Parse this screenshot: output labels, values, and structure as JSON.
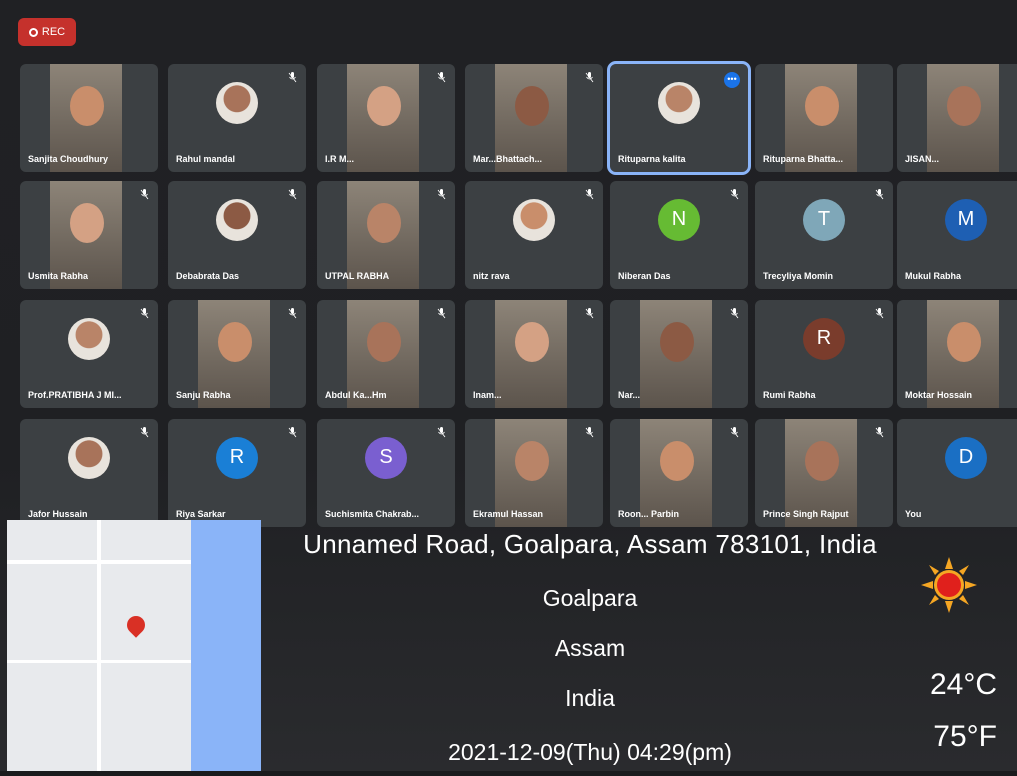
{
  "rec_label": "REC",
  "participants": [
    {
      "name": "Sanjita Choudhury",
      "kind": "photo"
    },
    {
      "name": "Rahul mandal",
      "kind": "avatar-img",
      "muted": true
    },
    {
      "name": "I.R M...",
      "kind": "photo",
      "muted": true
    },
    {
      "name": "Mar...Bhattach...",
      "kind": "photo",
      "muted": true
    },
    {
      "name": "Rituparna kalita",
      "kind": "avatar-img",
      "active": true
    },
    {
      "name": "Rituparna Bhatta...",
      "kind": "photo"
    },
    {
      "name": "JISAN...",
      "kind": "photo",
      "muted": true
    },
    {
      "name": "Usmita Rabha",
      "kind": "photo",
      "muted": true
    },
    {
      "name": "Debabrata Das",
      "kind": "avatar-img",
      "muted": true
    },
    {
      "name": "UTPAL RABHA",
      "kind": "photo",
      "muted": true
    },
    {
      "name": "nitz rava",
      "kind": "avatar-img",
      "muted": true
    },
    {
      "name": "Niberan Das",
      "kind": "letter",
      "letter": "N",
      "color": "#66bb33",
      "muted": true
    },
    {
      "name": "Trecyliya Momin",
      "kind": "letter",
      "letter": "T",
      "color": "#7fa7b8",
      "muted": true
    },
    {
      "name": "Mukul Rabha",
      "kind": "letter",
      "letter": "M",
      "color": "#1e5fb3",
      "muted": true
    },
    {
      "name": "Prof.PRATIBHA J MI...",
      "kind": "avatar-img",
      "muted": true
    },
    {
      "name": "Sanju Rabha",
      "kind": "photo",
      "muted": true
    },
    {
      "name": "Abdul Ka...Hm",
      "kind": "photo",
      "muted": true
    },
    {
      "name": "Inam...",
      "kind": "photo",
      "muted": true
    },
    {
      "name": "Nar...",
      "kind": "photo",
      "muted": true
    },
    {
      "name": "Rumi Rabha",
      "kind": "letter",
      "letter": "R",
      "color": "#7a3c2c",
      "muted": true
    },
    {
      "name": "Moktar Hossain",
      "kind": "photo",
      "muted": true
    },
    {
      "name": "Jafor Hussain",
      "kind": "avatar-img",
      "muted": true
    },
    {
      "name": "Riya Sarkar",
      "kind": "letter",
      "letter": "R",
      "color": "#1a7fd6",
      "muted": true
    },
    {
      "name": "Suchismita Chakrab...",
      "kind": "letter",
      "letter": "S",
      "color": "#7a5fd0",
      "muted": true
    },
    {
      "name": "Ekramul Hassan",
      "kind": "photo",
      "muted": true
    },
    {
      "name": "Roon... Parbin",
      "kind": "photo",
      "muted": true
    },
    {
      "name": "Prince Singh Rajput",
      "kind": "photo",
      "muted": true
    },
    {
      "name": "You",
      "kind": "letter",
      "letter": "D",
      "color": "#1a6fc4",
      "muted": true
    }
  ],
  "geo": {
    "address": "Unnamed Road, Goalpara, Assam 783101, India",
    "city": "Goalpara",
    "state": "Assam",
    "country": "India",
    "datetime": "2021-12-09(Thu)   04:29(pm)"
  },
  "weather": {
    "celsius": "24°C",
    "fahrenheit": "75°F",
    "icon": "sun-icon"
  }
}
